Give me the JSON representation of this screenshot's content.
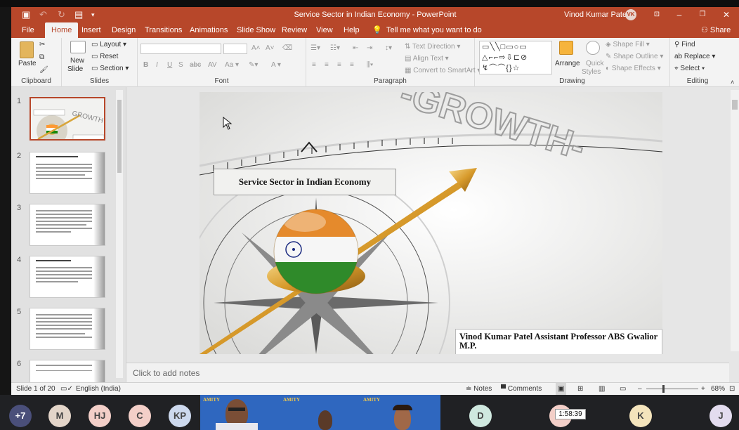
{
  "window": {
    "title": "Service Sector in Indian Economy  -  PowerPoint",
    "user_name": "Vinod Kumar Patel",
    "user_initials": "VK"
  },
  "tabs": [
    {
      "label": "File"
    },
    {
      "label": "Home"
    },
    {
      "label": "Insert"
    },
    {
      "label": "Design"
    },
    {
      "label": "Transitions"
    },
    {
      "label": "Animations"
    },
    {
      "label": "Slide Show"
    },
    {
      "label": "Review"
    },
    {
      "label": "View"
    },
    {
      "label": "Help"
    }
  ],
  "tell_me": "Tell me what you want to do",
  "share_label": "Share",
  "ribbon": {
    "clipboard": {
      "label": "Clipboard",
      "paste": "Paste"
    },
    "slides": {
      "label": "Slides",
      "new_slide_1": "New",
      "new_slide_2": "Slide",
      "layout": "Layout",
      "reset": "Reset",
      "section": "Section"
    },
    "font": {
      "label": "Font"
    },
    "paragraph": {
      "label": "Paragraph",
      "text_direction": "Text Direction",
      "align_text": "Align Text",
      "convert_smartart": "Convert to SmartArt"
    },
    "drawing": {
      "label": "Drawing",
      "arrange": "Arrange",
      "quick_styles_1": "Quick",
      "quick_styles_2": "Styles",
      "shape_fill": "Shape Fill",
      "shape_outline": "Shape Outline",
      "shape_effects": "Shape Effects"
    },
    "editing": {
      "label": "Editing",
      "find": "Find",
      "replace": "Replace",
      "select": "Select"
    }
  },
  "thumbnails": [
    {
      "number": "1",
      "selected": true
    },
    {
      "number": "2",
      "selected": false
    },
    {
      "number": "3",
      "selected": false
    },
    {
      "number": "4",
      "selected": false
    },
    {
      "number": "5",
      "selected": false
    },
    {
      "number": "6",
      "selected": false
    }
  ],
  "slide": {
    "title": "Service Sector in Indian Economy",
    "author": "Vinod Kumar Patel  Assistant Professor ABS Gwalior M.P.",
    "compass_text": "-GROWTH-"
  },
  "notes_placeholder": "Click to add notes",
  "status": {
    "slide_count": "Slide 1 of 20",
    "language": "English (India)",
    "notes": "Notes",
    "comments": "Comments",
    "zoom": "68%"
  },
  "meeting": {
    "participants": [
      {
        "initials": "+7",
        "color": "#4a4f7a"
      },
      {
        "initials": "M",
        "color": "#e3d5c9"
      },
      {
        "initials": "HJ",
        "color": "#f3cfc8"
      },
      {
        "initials": "C",
        "color": "#f3cfc8"
      },
      {
        "initials": "KP",
        "color": "#cdd9ee"
      },
      {
        "initials": "D",
        "color": "#cfe8df"
      },
      {
        "initials": "K",
        "color": "#f4e4bc"
      },
      {
        "initials": "J",
        "color": "#e3dcef"
      }
    ],
    "video_brand": "AMITY",
    "timer": "1:58:39"
  },
  "colors": {
    "accent": "#b7472a",
    "ribbon_bg": "#f3f3f3"
  }
}
